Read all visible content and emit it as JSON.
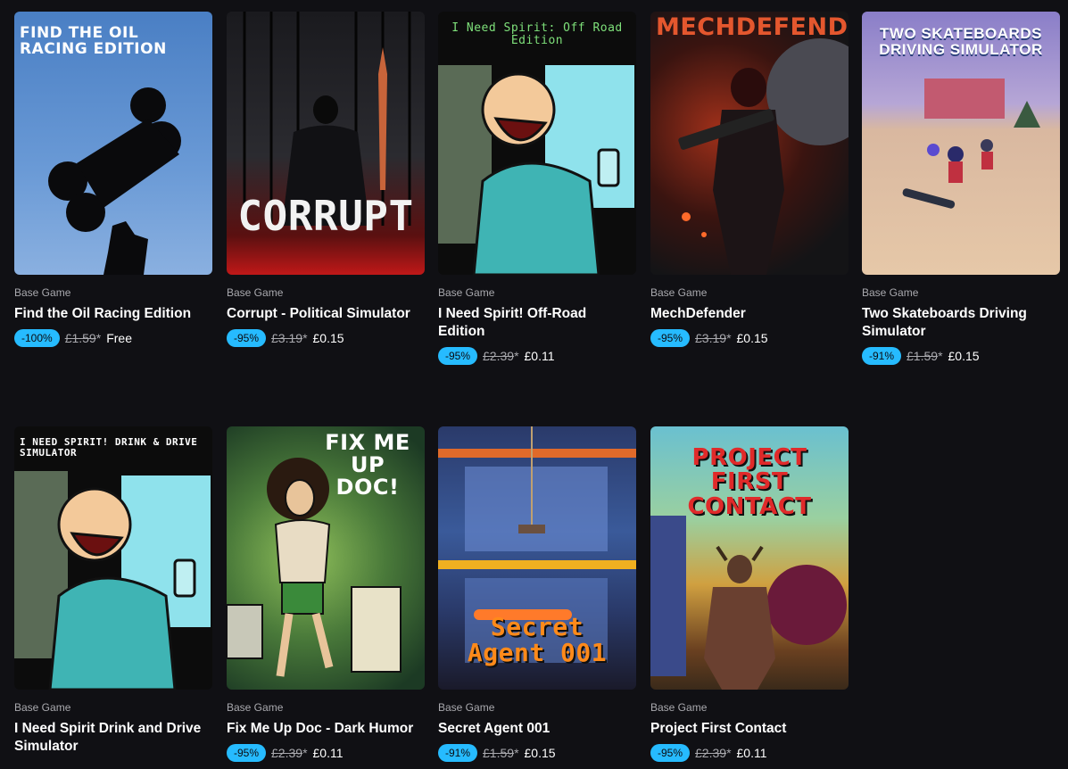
{
  "cards": [
    {
      "art_text": "FIND THE OIL RACING EDITION",
      "type": "Base Game",
      "title": "Find the Oil Racing Edition",
      "discount": "-100%",
      "original_price": "£1.59",
      "asterisk": "*",
      "price": "Free"
    },
    {
      "art_text": "CORRUPT",
      "type": "Base Game",
      "title": "Corrupt - Political Simulator",
      "discount": "-95%",
      "original_price": "£3.19",
      "asterisk": "*",
      "price": "£0.15"
    },
    {
      "art_text": "I Need Spirit: Off Road Edition",
      "type": "Base Game",
      "title": "I Need Spirit! Off-Road Edition",
      "discount": "-95%",
      "original_price": "£2.39",
      "asterisk": "*",
      "price": "£0.11"
    },
    {
      "art_text": "MECHDEFENDER",
      "type": "Base Game",
      "title": "MechDefender",
      "discount": "-95%",
      "original_price": "£3.19",
      "asterisk": "*",
      "price": "£0.15"
    },
    {
      "art_text": "TWO SKATEBOARDS DRIVING SIMULATOR",
      "type": "Base Game",
      "title": "Two Skateboards Driving Simulator",
      "discount": "-91%",
      "original_price": "£1.59",
      "asterisk": "*",
      "price": "£0.15"
    },
    {
      "art_text": "I NEED SPIRIT! DRINK & DRIVE SIMULATOR",
      "type": "Base Game",
      "title": "I Need Spirit Drink and Drive Simulator",
      "discount": "",
      "original_price": "",
      "asterisk": "",
      "price": ""
    },
    {
      "art_text": "FIX ME UP DOC!",
      "type": "Base Game",
      "title": "Fix Me Up Doc - Dark Humor",
      "discount": "-95%",
      "original_price": "£2.39",
      "asterisk": "*",
      "price": "£0.11"
    },
    {
      "art_text": "Secret Agent 001",
      "type": "Base Game",
      "title": "Secret Agent 001",
      "discount": "-91%",
      "original_price": "£1.59",
      "asterisk": "*",
      "price": "£0.15"
    },
    {
      "art_text": "PROJECT FIRST CONTACT",
      "type": "Base Game",
      "title": "Project First Contact",
      "discount": "-95%",
      "original_price": "£2.39",
      "asterisk": "*",
      "price": "£0.11"
    }
  ],
  "colors": {
    "background": "#101014",
    "discount_badge": "#26bbff",
    "secondary_text": "#a9a9ae"
  }
}
